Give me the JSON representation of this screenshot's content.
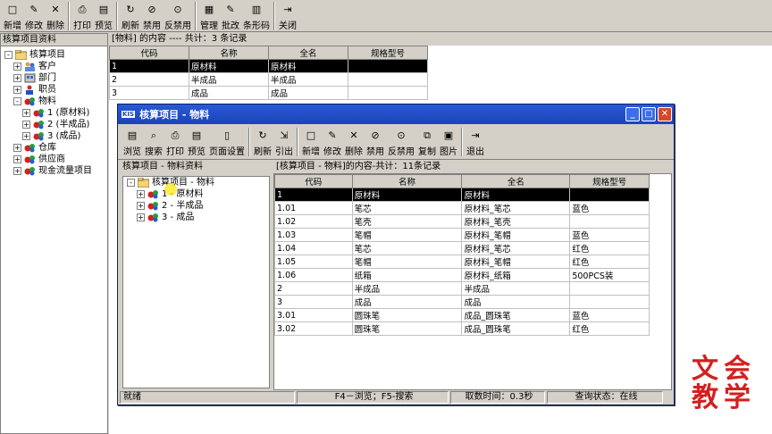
{
  "toolbar": [
    {
      "name": "new",
      "label": "新增",
      "icon": "□"
    },
    {
      "name": "edit",
      "label": "修改",
      "icon": "✎"
    },
    {
      "name": "delete",
      "label": "删除",
      "icon": "✕"
    },
    {
      "sep": true
    },
    {
      "name": "print",
      "label": "打印",
      "icon": "⎙"
    },
    {
      "name": "preview",
      "label": "预览",
      "icon": "▤"
    },
    {
      "sep": true
    },
    {
      "name": "refresh",
      "label": "刷新",
      "icon": "↻"
    },
    {
      "name": "disable",
      "label": "禁用",
      "icon": "⊘"
    },
    {
      "name": "undisable",
      "label": "反禁用",
      "icon": "⊙"
    },
    {
      "sep": true
    },
    {
      "name": "manage",
      "label": "管理",
      "icon": "▦"
    },
    {
      "name": "batch-edit",
      "label": "批改",
      "icon": "✎"
    },
    {
      "name": "barcode",
      "label": "条形码",
      "icon": "▥"
    },
    {
      "sep": true
    },
    {
      "name": "close",
      "label": "关闭",
      "icon": "⇥"
    }
  ],
  "left_panel": {
    "title": "核算项目资料",
    "tree": [
      {
        "label": "核算项目",
        "level": 0,
        "pm": "-",
        "icon": "folder"
      },
      {
        "label": "客户",
        "level": 1,
        "pm": "+",
        "icon": "people"
      },
      {
        "label": "部门",
        "level": 1,
        "pm": "+",
        "icon": "dept"
      },
      {
        "label": "职员",
        "level": 1,
        "pm": "+",
        "icon": "person"
      },
      {
        "label": "物料",
        "level": 1,
        "pm": "-",
        "icon": "balls"
      },
      {
        "label": "1 (原材料)",
        "level": 2,
        "pm": "+",
        "icon": "balls"
      },
      {
        "label": "2 (半成品)",
        "level": 2,
        "pm": "+",
        "icon": "balls"
      },
      {
        "label": "3 (成品)",
        "level": 2,
        "pm": "+",
        "icon": "balls"
      },
      {
        "label": "仓库",
        "level": 1,
        "pm": "+",
        "icon": "balls"
      },
      {
        "label": "供应商",
        "level": 1,
        "pm": "+",
        "icon": "balls"
      },
      {
        "label": "现金流量项目",
        "level": 1,
        "pm": "+",
        "icon": "balls"
      }
    ]
  },
  "main_grid": {
    "title": "[物料] 的内容 ---- 共计：3 条记录",
    "columns": [
      "代码",
      "名称",
      "全名",
      "规格型号"
    ],
    "rows": [
      [
        "1",
        "原材料",
        "原材料",
        ""
      ],
      [
        "2",
        "半成品",
        "半成品",
        ""
      ],
      [
        "3",
        "成品",
        "成品",
        ""
      ]
    ]
  },
  "window": {
    "title": "核算项目 - 物料",
    "kis": "KIS",
    "toolbar": [
      {
        "name": "browse",
        "label": "浏览",
        "icon": "▤"
      },
      {
        "name": "search",
        "label": "搜索",
        "icon": "⌕"
      },
      {
        "name": "print",
        "label": "打印",
        "icon": "⎙"
      },
      {
        "name": "preview",
        "label": "预览",
        "icon": "▤"
      },
      {
        "name": "page-setup",
        "label": "页面设置",
        "icon": "▯"
      },
      {
        "sep": true
      },
      {
        "name": "refresh",
        "label": "刷新",
        "icon": "↻"
      },
      {
        "name": "import",
        "label": "引出",
        "icon": "⇲"
      },
      {
        "sep": true
      },
      {
        "name": "new",
        "label": "新增",
        "icon": "□"
      },
      {
        "name": "edit",
        "label": "修改",
        "icon": "✎"
      },
      {
        "name": "delete",
        "label": "删除",
        "icon": "✕"
      },
      {
        "name": "disable",
        "label": "禁用",
        "icon": "⊘"
      },
      {
        "name": "undisable",
        "label": "反禁用",
        "icon": "⊙"
      },
      {
        "name": "copy",
        "label": "复制",
        "icon": "⧉"
      },
      {
        "name": "picture",
        "label": "图片",
        "icon": "▣"
      },
      {
        "sep": true
      },
      {
        "name": "exit",
        "label": "退出",
        "icon": "⇥"
      }
    ],
    "left_title": "核算项目 - 物料资料",
    "tree": [
      {
        "label": "核算项目 - 物料",
        "level": 0,
        "pm": "-",
        "icon": "folder"
      },
      {
        "label": "1 - 原材料",
        "level": 1,
        "pm": "+",
        "icon": "balls"
      },
      {
        "label": "2 - 半成品",
        "level": 1,
        "pm": "+",
        "icon": "balls"
      },
      {
        "label": "3 - 成品",
        "level": 1,
        "pm": "+",
        "icon": "balls"
      }
    ],
    "grid_title": "[核算项目 - 物料]的内容-共计：11条记录",
    "columns": [
      "代码",
      "名称",
      "全名",
      "规格型号"
    ],
    "rows": [
      [
        "1",
        "原材料",
        "原材料",
        ""
      ],
      [
        "1.01",
        "笔芯",
        "原材料_笔芯",
        "蓝色"
      ],
      [
        "1.02",
        "笔壳",
        "原材料_笔壳",
        ""
      ],
      [
        "1.03",
        "笔帽",
        "原材料_笔帽",
        "蓝色"
      ],
      [
        "1.04",
        "笔芯",
        "原材料_笔芯",
        "红色"
      ],
      [
        "1.05",
        "笔帽",
        "原材料_笔帽",
        "红色"
      ],
      [
        "1.06",
        "纸箱",
        "原材料_纸箱",
        "500PCS装"
      ],
      [
        "2",
        "半成品",
        "半成品",
        ""
      ],
      [
        "3",
        "成品",
        "成品",
        ""
      ],
      [
        "3.01",
        "圆珠笔",
        "成品_圆珠笔",
        "蓝色"
      ],
      [
        "3.02",
        "圆珠笔",
        "成品_圆珠笔",
        "红色"
      ]
    ],
    "status": [
      "就绪",
      "F4－浏览；F5-搜索",
      "取数时间：0.3秒",
      "查询状态：在线"
    ]
  },
  "watermark": {
    "line1": "文会",
    "line2": "教学"
  },
  "colors": {
    "title_bar": "#1a44b8",
    "selection": "#000000",
    "watermark": "#d42020"
  }
}
